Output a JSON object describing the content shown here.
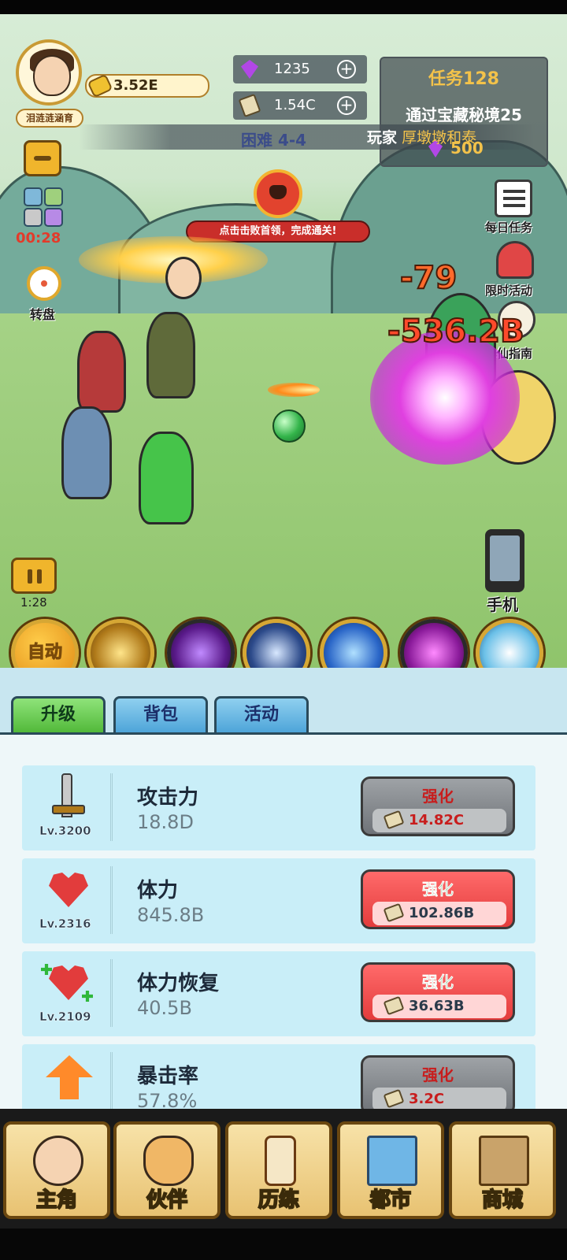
{
  "player": {
    "name": "泪涟涟涵育",
    "gold": "3.52E"
  },
  "resources": {
    "gems": "1235",
    "cash": "1.54C"
  },
  "task": {
    "title": "任务128",
    "description": "通过宝藏秘境25",
    "reward": "500"
  },
  "stage": {
    "difficulty": "困难 4-4",
    "notice_prefix": "玩家",
    "notice_player": "厚墩墩和泰"
  },
  "left_icons": {
    "timer": "00:28",
    "wheel_label": "转盘"
  },
  "right_icons": {
    "daily_tasks": "每日任务",
    "limited_event": "限时活动",
    "cultivation_guide": "修仙指南",
    "phone": "手机"
  },
  "boss": {
    "hint": "点击击败首领，完成通关!"
  },
  "battle": {
    "damage_1": "-79",
    "damage_2": "-536.2B",
    "pause_time": "1:28"
  },
  "skills": {
    "auto_label": "自动"
  },
  "tabs": [
    {
      "label": "升级"
    },
    {
      "label": "背包"
    },
    {
      "label": "活动"
    }
  ],
  "upgrades": [
    {
      "name": "攻击力",
      "value": "18.8D",
      "level": "Lv.3200",
      "button": "强化",
      "cost": "14.82C",
      "affordable": false
    },
    {
      "name": "体力",
      "value": "845.8B",
      "level": "Lv.2316",
      "button": "强化",
      "cost": "102.86B",
      "affordable": true
    },
    {
      "name": "体力恢复",
      "value": "40.5B",
      "level": "Lv.2109",
      "button": "强化",
      "cost": "36.63B",
      "affordable": true
    },
    {
      "name": "暴击率",
      "value": "57.8%",
      "level": "",
      "button": "强化",
      "cost": "3.2C",
      "affordable": false
    }
  ],
  "nav": [
    {
      "label": "主角"
    },
    {
      "label": "伙伴"
    },
    {
      "label": "历练"
    },
    {
      "label": "都市"
    },
    {
      "label": "商城"
    }
  ],
  "colors": {
    "accent_gold": "#f0b52c",
    "affordable_button": "#e33c3c",
    "locked_button": "#6f7378",
    "tab_active": "#52b93a",
    "tab_inactive": "#4ea5d9"
  }
}
